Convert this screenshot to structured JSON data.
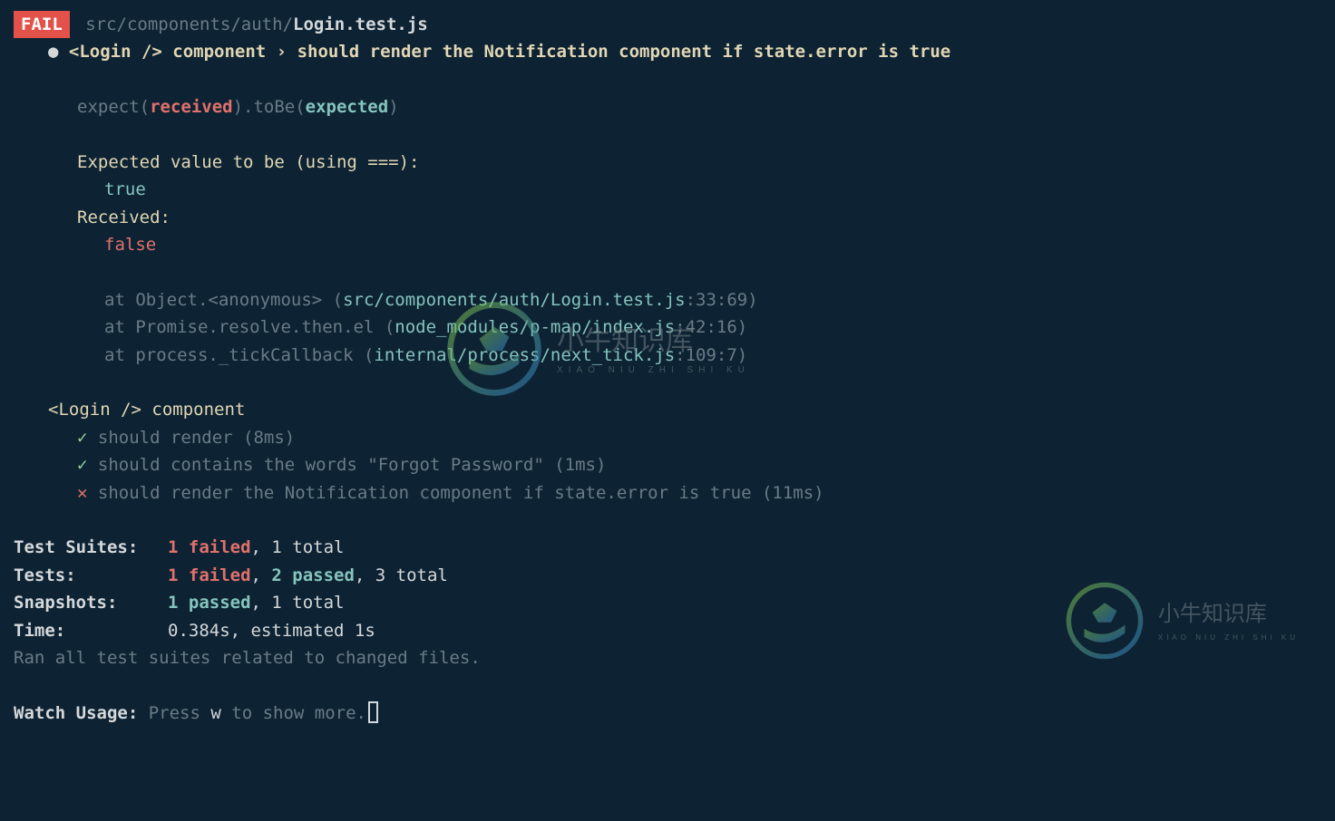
{
  "header": {
    "fail_badge": "FAIL",
    "path_dim": "src/components/auth/",
    "path_file": "Login.test.js"
  },
  "fail_line": {
    "prefix": "<Login /> component",
    "sep": " › ",
    "desc": "should render the Notification component if state.error is true"
  },
  "expect_line": {
    "p1": "expect(",
    "received": "received",
    "p2": ").toBe(",
    "expected": "expected",
    "p3": ")"
  },
  "expected": {
    "intro": "Expected value to be (using ===):",
    "value": "true",
    "received_label": "Received:",
    "received_value": "false"
  },
  "stack": {
    "l1": {
      "pre": "at Object.<anonymous> (",
      "file": "src/components/auth/Login.test.js",
      "loc": ":33:69)"
    },
    "l2": {
      "pre": "at Promise.resolve.then.el (",
      "file": "node_modules/p-map/index.js",
      "loc": ":42:16)"
    },
    "l3": {
      "pre": "at process._tickCallback (",
      "file": "internal/process/next_tick.js",
      "loc": ":109:7)"
    }
  },
  "suite": {
    "title": "<Login /> component",
    "t1": "should render (8ms)",
    "t2": "should contains the words \"Forgot Password\" (1ms)",
    "t3": "should render the Notification component if state.error is true (11ms)"
  },
  "summary": {
    "suites_label": "Test Suites:",
    "suites_fail": "1 failed",
    "suites_rest": ", 1 total",
    "tests_label": "Tests:",
    "tests_fail": "1 failed",
    "tests_mid": ", ",
    "tests_pass": "2 passed",
    "tests_rest": ", 3 total",
    "snap_label": "Snapshots:",
    "snap_pass": "1 passed",
    "snap_rest": ", 1 total",
    "time_label": "Time:",
    "time_rest": "0.384s, estimated 1s",
    "ran": "Ran all test suites related to changed files."
  },
  "watch": {
    "label": "Watch Usage:",
    "pre": " Press ",
    "key": "w",
    "post": " to show more."
  },
  "watermark": {
    "title": "小牛知识库",
    "sub": "XIAO NIU ZHI SHI KU"
  }
}
